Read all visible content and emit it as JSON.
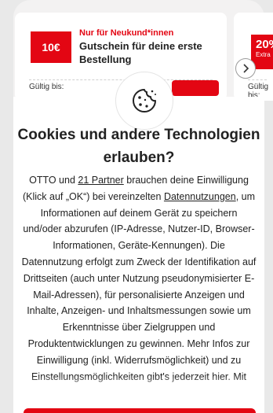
{
  "coupons": [
    {
      "badge": "10€",
      "kicker": "Nur für Neukund*innen",
      "title": "Gutschein für deine erste Bestellung",
      "valid_label": "Gültig bis:"
    },
    {
      "badge": "20%",
      "badge_sub": "Extra",
      "valid_label": "Gültig bis:"
    }
  ],
  "consent": {
    "heading": "Cookies und andere Technologien erlauben?",
    "body_part1": "OTTO und ",
    "partners_link": "21 Partner",
    "body_part2": " brauchen deine Einwilligung (Klick auf „OK“) bei vereinzelten ",
    "datennutzungen_link": "Datennutzungen",
    "body_part3": ", um Informationen auf deinem Gerät zu speichern und/oder abzurufen (IP-Adresse, Nutzer-ID, Browser-Informationen, Geräte-Kennungen). Die Datennutzung erfolgt zum Zweck der Identifikation auf Drittseiten (auch unter Nutzung pseudonymisierter E-Mail-Adressen), für personalisierte Anzeigen und Inhalte, Anzeigen- und Inhaltsmessungen sowie um Erkenntnisse über Zielgruppen und Produktentwicklungen zu gewinnen. Mehr Infos zur Einwilligung (inkl. Widerrufsmöglichkeit) und zu Einstellungsmöglichkeiten gibt's jederzeit hier. Mit"
  },
  "colors": {
    "accent": "#e30613",
    "text": "#222222"
  },
  "icons": {
    "cookie": "cookie-icon",
    "next": "chevron-right-icon"
  }
}
